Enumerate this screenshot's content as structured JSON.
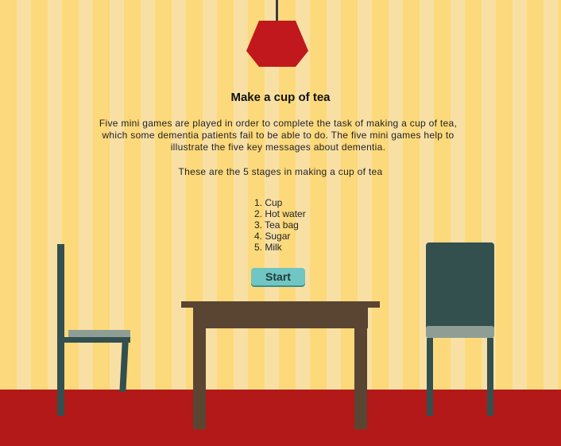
{
  "game": {
    "title": "Make a cup of tea",
    "intro": "Five mini games are played in order to complete the task of making a cup of tea, which some dementia patients fail to be able to do. The five mini games help to illustrate the five key messages about dementia.",
    "stages_intro": "These are the 5 stages in making a cup of tea",
    "stages": [
      "1. Cup",
      "2. Hot water",
      "3. Tea bag",
      "4. Sugar",
      "5. Milk"
    ],
    "start_label": "Start"
  },
  "colors": {
    "wall_stripe_a": "#fcd97a",
    "wall_stripe_b": "#f8e0a4",
    "floor": "#b31919",
    "lamp": "#c0181d",
    "table": "#5a4533",
    "chair": "#33504f",
    "chair_seat": "#8e9e94",
    "button": "#6fc6c2"
  }
}
